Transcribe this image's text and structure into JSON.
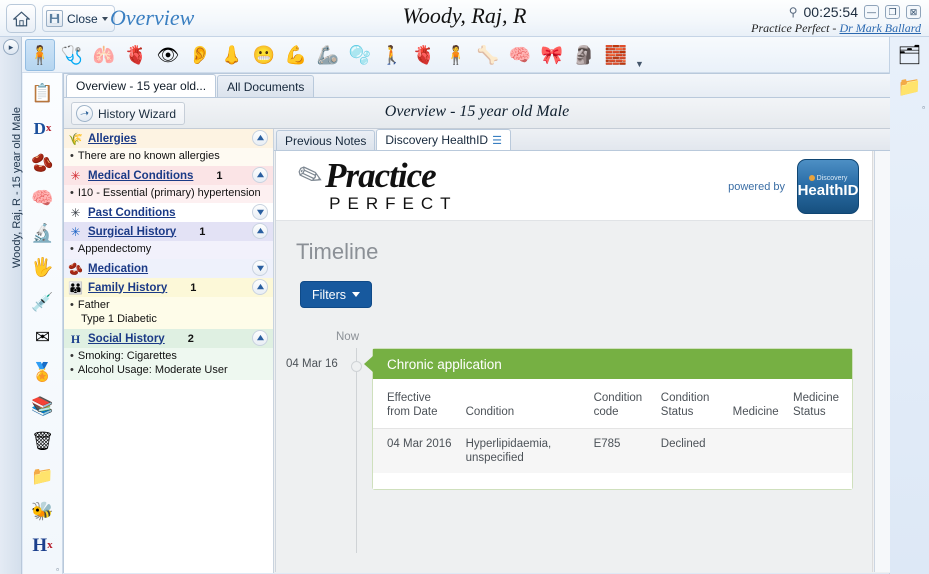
{
  "titlebar": {
    "home_icon": "home-icon",
    "close_label": "Close",
    "overview_link": "Overview",
    "patient_name": "Woody, Raj, R",
    "pin_icon": "pin-icon",
    "clock_time": "00:25:54",
    "minimize_label": "—",
    "restore_label": "❐",
    "close_window_label": "⊠",
    "practice_label": "Practice Perfect - ",
    "doctor_link": "Dr Mark Ballard"
  },
  "toolbar": {
    "icons": [
      {
        "name": "body-torso-icon",
        "glyph": "🧍",
        "selected": true
      },
      {
        "name": "stethoscope-icon",
        "glyph": "🩺",
        "selected": false
      },
      {
        "name": "lungs-icon",
        "glyph": "🫁",
        "selected": false
      },
      {
        "name": "heart-icon",
        "glyph": "🫀",
        "selected": false
      },
      {
        "name": "eye-icon",
        "glyph": "👁",
        "selected": false
      },
      {
        "name": "ear-icon",
        "glyph": "👂",
        "selected": false
      },
      {
        "name": "nose-icon",
        "glyph": "👃",
        "selected": false
      },
      {
        "name": "mouth-throat-icon",
        "glyph": "😬",
        "selected": false
      },
      {
        "name": "skin-arm-icon",
        "glyph": "💪",
        "selected": false
      },
      {
        "name": "shoulder-icon",
        "glyph": "🦾",
        "selected": false
      },
      {
        "name": "stomach-icon",
        "glyph": "🫧",
        "selected": false
      },
      {
        "name": "full-body-icon",
        "glyph": "🚶",
        "selected": false
      },
      {
        "name": "kidney-icon",
        "glyph": "🫀",
        "selected": false
      },
      {
        "name": "abdomen-icon",
        "glyph": "🧍",
        "selected": false
      },
      {
        "name": "spine-icon",
        "glyph": "🦴",
        "selected": false
      },
      {
        "name": "brain-icon",
        "glyph": "🧠",
        "selected": false
      },
      {
        "name": "hiv-ribbon-icon",
        "glyph": "🎀",
        "selected": false
      },
      {
        "name": "anatomy-model-icon",
        "glyph": "🗿",
        "selected": false
      },
      {
        "name": "paediatrics-blocks-icon",
        "glyph": "🧱",
        "selected": false
      }
    ],
    "more_label": "▼"
  },
  "left_rail": {
    "expand_icon": "chevron-right-icon",
    "patient_label": "Woody, Raj, R - 15 year old Male",
    "icons": [
      {
        "name": "clipboard-notes-icon",
        "glyph": "📋"
      },
      {
        "name": "diagnosis-dx-icon",
        "glyph": "D"
      },
      {
        "name": "prescription-mortar-icon",
        "glyph": "🫘"
      },
      {
        "name": "brain-scan-icon",
        "glyph": "🧠"
      },
      {
        "name": "microscope-icon",
        "glyph": "🔬"
      },
      {
        "name": "xray-hand-icon",
        "glyph": "🖐"
      },
      {
        "name": "syringe-icon",
        "glyph": "💉"
      },
      {
        "name": "mail-envelope-icon",
        "glyph": "✉"
      },
      {
        "name": "certificate-icon",
        "glyph": "🏅"
      },
      {
        "name": "file-folder-icon",
        "glyph": "📚"
      },
      {
        "name": "recycle-bin-icon",
        "glyph": "🗑"
      },
      {
        "name": "medical-folder-icon",
        "glyph": "📁"
      },
      {
        "name": "insect-bee-icon",
        "glyph": "🐝"
      },
      {
        "name": "history-hx-icon",
        "glyph": "H"
      }
    ],
    "more_label": "▫"
  },
  "right_rail": {
    "icons": [
      {
        "name": "blue-folder-icon",
        "glyph": "🗂"
      },
      {
        "name": "yellow-folder-icon",
        "glyph": "📁"
      }
    ],
    "more_label": "▫"
  },
  "main": {
    "tabs": [
      {
        "label": "Overview - 15 year old...",
        "active": true
      },
      {
        "label": "All Documents",
        "active": false
      }
    ],
    "wizard_button": "History Wizard",
    "wizard_icon": "wizard-wand-icon",
    "page_heading": "Overview - 15 year old Male"
  },
  "summary": {
    "sections": [
      {
        "title": "Allergies",
        "count": "",
        "icon": "allergy-feather-icon",
        "icon_glyph": "🌾",
        "bg": "#fdf3e2",
        "body_bg": "#fefaf2",
        "toggle": "collapse",
        "items": [
          {
            "bullet": true,
            "text": "There are no known allergies"
          }
        ]
      },
      {
        "title": "Medical Conditions",
        "count": "1",
        "icon": "medical-star-red-icon",
        "icon_glyph": "✳",
        "bg": "#fbe4e6",
        "body_bg": "#fdf0f1",
        "toggle": "collapse",
        "items": [
          {
            "bullet": true,
            "text": "I10 - Essential (primary) hypertension"
          }
        ]
      },
      {
        "title": "Past Conditions",
        "count": "",
        "icon": "medical-star-dark-icon",
        "icon_glyph": "✳",
        "bg": "#ffffff",
        "body_bg": "#ffffff",
        "toggle": "expand",
        "items": []
      },
      {
        "title": "Surgical History",
        "count": "1",
        "icon": "medical-star-blue-icon",
        "icon_glyph": "✳",
        "bg": "#e3e2f5",
        "body_bg": "#f2f1fb",
        "toggle": "collapse",
        "items": [
          {
            "bullet": true,
            "text": "Appendectomy"
          }
        ]
      },
      {
        "title": "Medication",
        "count": "",
        "icon": "medication-mortar-icon",
        "icon_glyph": "🫘",
        "bg": "#eef1fb",
        "body_bg": "#ffffff",
        "toggle": "expand",
        "items": []
      },
      {
        "title": "Family History",
        "count": "1",
        "icon": "family-people-icon",
        "icon_glyph": "👪",
        "bg": "#fcf8d8",
        "body_bg": "#fefce9",
        "toggle": "collapse",
        "items": [
          {
            "bullet": true,
            "text": "Father"
          },
          {
            "bullet": false,
            "text": "Type 1 Diabetic"
          }
        ]
      },
      {
        "title": "Social History",
        "count": "2",
        "icon": "history-hx-icon",
        "icon_glyph": "H",
        "bg": "#dff0e2",
        "body_bg": "#eef8f0",
        "toggle": "collapse",
        "items": [
          {
            "bullet": true,
            "text": "Smoking: Cigarettes"
          },
          {
            "bullet": true,
            "text": "Alcohol Usage: Moderate User"
          }
        ]
      }
    ]
  },
  "content": {
    "tabs": [
      {
        "label": "Previous Notes",
        "active": false,
        "badge": ""
      },
      {
        "label": "Discovery HealthID",
        "active": true,
        "badge": "☰"
      }
    ],
    "brand": {
      "logo_glyph": "pen-nib-icon",
      "logo_practice": "Practice",
      "logo_perfect": "PERFECT",
      "powered_by": "powered by",
      "healthid_top": "Discovery",
      "healthid_main": "HealthID"
    },
    "timeline_title": "Timeline",
    "filters_button": "Filters",
    "timeline": {
      "now_label": "Now",
      "entry_date_label": "04 Mar 16",
      "card_title": "Chronic application",
      "columns": [
        "Effective from Date",
        "Condition",
        "Condition code",
        "Condition Status",
        "Medicine",
        "Medicine Status"
      ],
      "rows": [
        {
          "effective_from_date": "04 Mar 2016",
          "condition": "Hyperlipidaemia, unspecified",
          "condition_code": "E785",
          "condition_status": "Declined",
          "medicine": "",
          "medicine_status": ""
        }
      ]
    },
    "scroll_up_icon": "chevron-up-icon"
  },
  "colors": {
    "accent_blue": "#17599e",
    "timeline_green": "#76b043",
    "link_blue": "#2a68b0",
    "section_link": "#1b3a86"
  }
}
